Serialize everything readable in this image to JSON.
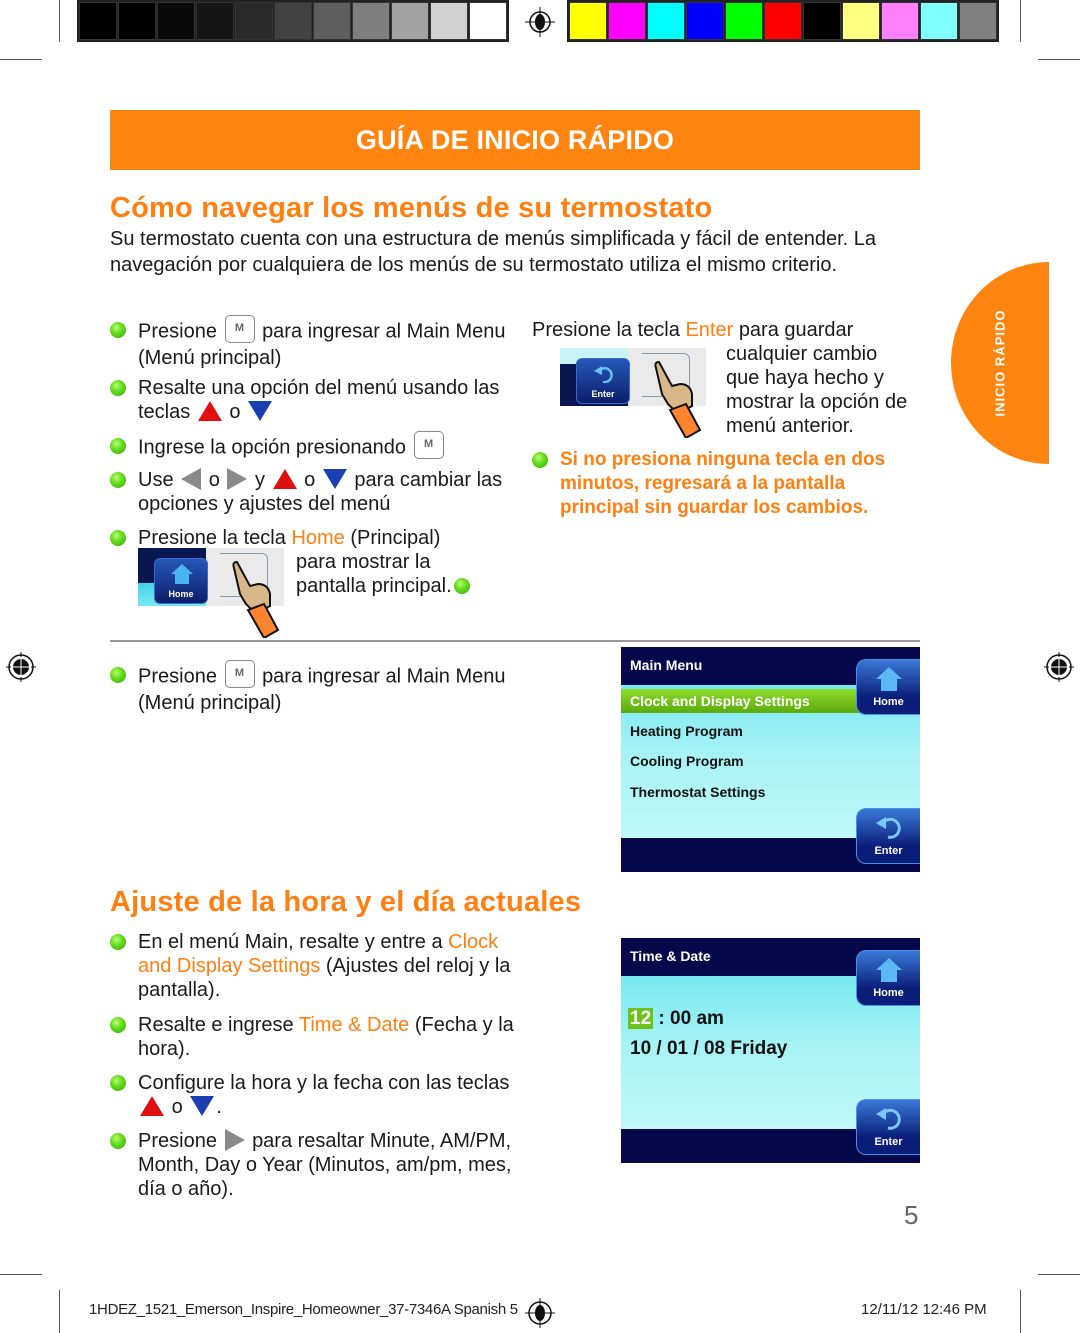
{
  "print_marks": {
    "grayscale_swatches": [
      "#000000",
      "#000000",
      "#0a0a0a",
      "#161616",
      "#2a2a2a",
      "#424242",
      "#5e5e5e",
      "#7e7e7e",
      "#a2a2a2",
      "#d0d0d0",
      "#ffffff"
    ],
    "color_swatches": [
      "#ffff00",
      "#ff00ff",
      "#00ffff",
      "#0000ff",
      "#00ff00",
      "#ff0000",
      "#000000",
      "#ffff80",
      "#ff80ff",
      "#80ffff",
      "#808080"
    ]
  },
  "banner": {
    "title": "GUÍA DE INICIO RÁPIDO"
  },
  "side_tab": {
    "label": "INICIO RÁPIDO"
  },
  "section1": {
    "heading": "Cómo navegar los menús de su termostato",
    "intro": "Su termostato cuenta con una estructura de menús simplificada y fácil de entender. La navegación por cualquiera de los menús de su termostato utiliza el mismo criterio.",
    "bullets": {
      "b1": {
        "a": "Presione",
        "b": "para ingresar al Main Menu (Menú principal)"
      },
      "b2": {
        "a": "Resalte una opción del menú usando las teclas",
        "b": "o"
      },
      "b3": {
        "a": "Ingrese la opción presionando"
      },
      "b4": {
        "a": "Use",
        "o1": "o",
        "y": "y",
        "o2": "o",
        "b": "para cambiar las opciones y ajustes del menú"
      },
      "b5": {
        "a": "Presione la tecla",
        "key": "Home",
        "b": "(Principal)",
        "c": "para mostrar la pantalla principal."
      }
    },
    "enter_block": {
      "a": "Presione la tecla",
      "key": "Enter",
      "b": "para guardar",
      "c": "cualquier cambio que haya hecho y mostrar la opción de menú anterior."
    },
    "warning": "Si no presiona ninguna tecla en dos minutos, regresará a la pantalla principal sin guardar los cambios.",
    "m_key_label": "M",
    "button_illus": {
      "home_label": "Home",
      "enter_label": "Enter"
    }
  },
  "main_menu_section": {
    "bullet": {
      "a": "Presione",
      "b": "para ingresar al Main Menu (Menú principal)"
    },
    "screen": {
      "title": "Main Menu",
      "selected_item": "Clock and Display Settings",
      "items": [
        "Heating Program",
        "Cooling Program",
        "Thermostat Settings"
      ],
      "home_button": "Home",
      "enter_button": "Enter"
    }
  },
  "section2": {
    "heading": "Ajuste de la hora y el día actuales",
    "bullets": {
      "b1": {
        "a": "En el menú Main, resalte y entre a",
        "key": "Clock and Display Settings",
        "b": "(Ajustes del reloj y la pantalla)."
      },
      "b2": {
        "a": "Resalte e ingrese",
        "key": "Time & Date",
        "b": "(Fecha y la hora)."
      },
      "b3": {
        "a": "Configure la hora y la fecha con las teclas",
        "o": "o",
        "end": "."
      },
      "b4": {
        "a": "Presione",
        "b": "para resaltar Minute, AM/PM, Month, Day o Year (Minutos, am/pm, mes, día o año)."
      }
    },
    "screen": {
      "title": "Time & Date",
      "hour": "12",
      "time_rest": ": 00 am",
      "date": "10 / 01 / 08  Friday",
      "home_button": "Home",
      "enter_button": "Enter"
    }
  },
  "page_number": "5",
  "footer": {
    "left": "1HDEZ_1521_Emerson_Inspire_Homeowner_37-7346A Spanish   5",
    "right": "12/11/12   12:46 PM"
  }
}
